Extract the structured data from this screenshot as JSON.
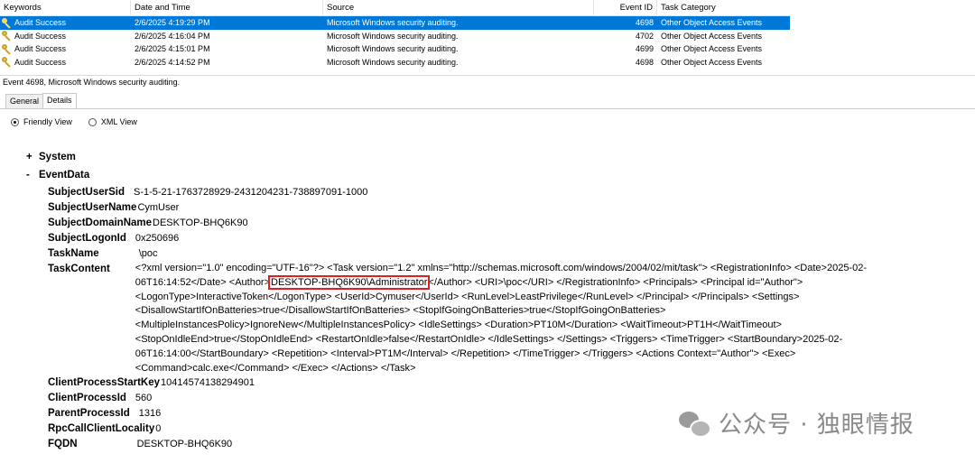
{
  "grid": {
    "columns": [
      "Keywords",
      "Date and Time",
      "Source",
      "Event ID",
      "Task Category"
    ],
    "rows": [
      {
        "keyword": "Audit Success",
        "datetime": "2/6/2025 4:19:29 PM",
        "source": "Microsoft Windows security auditing.",
        "event_id": "4698",
        "category": "Other Object Access Events",
        "selected": true
      },
      {
        "keyword": "Audit Success",
        "datetime": "2/6/2025 4:16:04 PM",
        "source": "Microsoft Windows security auditing.",
        "event_id": "4702",
        "category": "Other Object Access Events",
        "selected": false
      },
      {
        "keyword": "Audit Success",
        "datetime": "2/6/2025 4:15:01 PM",
        "source": "Microsoft Windows security auditing.",
        "event_id": "4699",
        "category": "Other Object Access Events",
        "selected": false
      },
      {
        "keyword": "Audit Success",
        "datetime": "2/6/2025 4:14:52 PM",
        "source": "Microsoft Windows security auditing.",
        "event_id": "4698",
        "category": "Other Object Access Events",
        "selected": false
      }
    ]
  },
  "detail": {
    "title": "Event 4698, Microsoft Windows security auditing.",
    "tabs": [
      "General",
      "Details"
    ],
    "active_tab": "Details",
    "view_options": [
      "Friendly View",
      "XML View"
    ],
    "selected_view": "Friendly View"
  },
  "tree": {
    "system": {
      "toggle": "+",
      "label": "System"
    },
    "eventdata": {
      "toggle": "-",
      "label": "EventData"
    },
    "fields_before": [
      {
        "name": "SubjectUserSid",
        "value": "S-1-5-21-1763728929-2431204231-738897091-1000"
      },
      {
        "name": "SubjectUserName",
        "value": "CymUser"
      },
      {
        "name": "SubjectDomainName",
        "value": "DESKTOP-BHQ6K90"
      },
      {
        "name": "SubjectLogonId",
        "value": "0x250696"
      },
      {
        "name": "TaskName",
        "value": "\\poc"
      }
    ],
    "task_content": {
      "name": "TaskContent",
      "before": "<?xml version=\"1.0\" encoding=\"UTF-16\"?> <Task version=\"1.2\" xmlns=\"http://schemas.microsoft.com/windows/2004/02/mit/task\"> <RegistrationInfo> <Date>2025-02-06T16:14:52</Date> <Author>",
      "highlight": "DESKTOP-BHQ6K90\\Administrator",
      "after": "</Author> <URI>\\poc</URI> </RegistrationInfo> <Principals> <Principal id=\"Author\"> <LogonType>InteractiveToken</LogonType> <UserId>Cymuser</UserId> <RunLevel>LeastPrivilege</RunLevel> </Principal> </Principals> <Settings> <DisallowStartIfOnBatteries>true</DisallowStartIfOnBatteries> <StopIfGoingOnBatteries>true</StopIfGoingOnBatteries> <MultipleInstancesPolicy>IgnoreNew</MultipleInstancesPolicy> <IdleSettings> <Duration>PT10M</Duration> <WaitTimeout>PT1H</WaitTimeout> <StopOnIdleEnd>true</StopOnIdleEnd> <RestartOnIdle>false</RestartOnIdle> </IdleSettings> </Settings> <Triggers> <TimeTrigger> <StartBoundary>2025-02-06T16:14:00</StartBoundary> <Repetition> <Interval>PT1M</Interval> </Repetition> </TimeTrigger> </Triggers> <Actions Context=\"Author\"> <Exec> <Command>calc.exe</Command> </Exec> </Actions> </Task>"
    },
    "fields_after": [
      {
        "name": "ClientProcessStartKey",
        "value": "10414574138294901"
      },
      {
        "name": "ClientProcessId",
        "value": "560"
      },
      {
        "name": "ParentProcessId",
        "value": "1316"
      },
      {
        "name": "RpcCallClientLocality",
        "value": "0"
      },
      {
        "name": "FQDN",
        "value": "DESKTOP-BHQ6K90"
      }
    ]
  },
  "watermark": {
    "text": "公众号 · 独眼情报",
    "icon": "wechat-icon"
  },
  "colors": {
    "selection": "#0078d7",
    "highlight_box": "#e02020"
  }
}
